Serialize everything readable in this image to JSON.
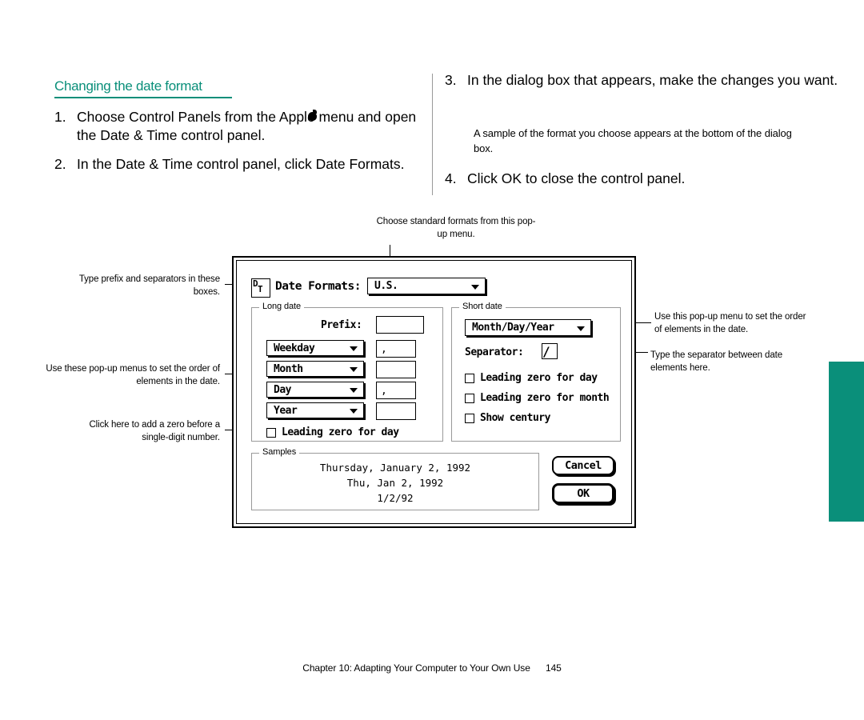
{
  "heading": "Changing the date format",
  "steps": [
    {
      "num": "1.",
      "text": "Choose Control Panels from the Apple menu and open the Date & Time control panel."
    },
    {
      "num": "2.",
      "text": "In the Date & Time control panel, click Date Formats."
    },
    {
      "num": "3.",
      "text": "In the dialog box that appears, make the changes you want."
    },
    {
      "num": "4.",
      "text": "Click OK to close the control panel."
    }
  ],
  "substep": "A sample of the format you choose appears at the bottom of the dialog box.",
  "callouts": {
    "top_center": "Choose standard formats from this pop-up menu.",
    "left_prefix": "Type prefix and separators in these boxes.",
    "left_popups": "Use these pop-up menus to set the order of elements in the date.",
    "left_leading_zero": "Click here to add a zero before a single-digit number.",
    "right_popup": "Use this pop-up menu to set the order of elements in the date.",
    "right_separator": "Type the separator between date elements here."
  },
  "dialog": {
    "icon_letters": {
      "d": "D",
      "t": "T"
    },
    "title": "Date Formats:",
    "standard_format": "U.S.",
    "long_date": {
      "group_label": "Long date",
      "prefix_label": "Prefix:",
      "prefix_value": "",
      "rows": [
        {
          "popup": "Weekday",
          "separator": ","
        },
        {
          "popup": "Month",
          "separator": ""
        },
        {
          "popup": "Day",
          "separator": ","
        },
        {
          "popup": "Year",
          "separator": ""
        }
      ],
      "leading_zero_day": "Leading zero for day"
    },
    "short_date": {
      "group_label": "Short date",
      "order_popup": "Month/Day/Year",
      "separator_label": "Separator:",
      "separator_value": "/",
      "checkboxes": [
        "Leading zero for day",
        "Leading zero for month",
        "Show century"
      ]
    },
    "samples": {
      "group_label": "Samples",
      "lines": [
        "Thursday, January 2, 1992",
        "Thu, Jan 2, 1992",
        "1/2/92"
      ]
    },
    "buttons": {
      "cancel": "Cancel",
      "ok": "OK"
    }
  },
  "footer": {
    "text": "Chapter 10: Adapting Your Computer to Your Own Use",
    "page": "145"
  },
  "colors": {
    "accent": "#0a8f7a",
    "text": "#000000",
    "rule": "#9a9a9a"
  }
}
